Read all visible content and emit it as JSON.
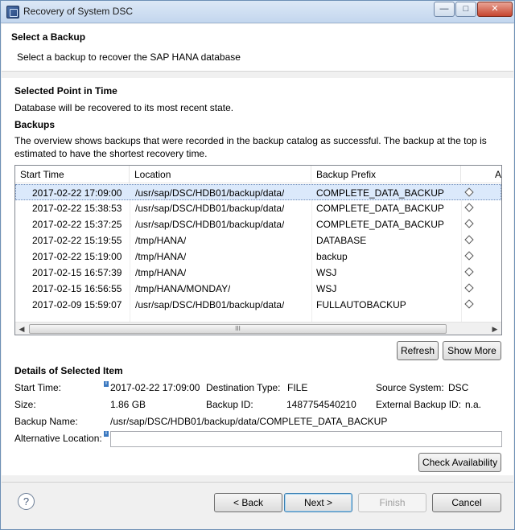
{
  "window": {
    "title": "Recovery of System DSC",
    "min_label": "—",
    "max_label": "□",
    "close_label": "✕"
  },
  "header": {
    "title": "Select a Backup",
    "description": "Select a backup to recover the SAP HANA database"
  },
  "point_in_time": {
    "heading": "Selected Point in Time",
    "text": "Database will be recovered to its most recent state."
  },
  "backups": {
    "heading": "Backups",
    "description_line1": "The overview shows backups that were recorded in the backup catalog as successful. The backup at the top is",
    "description_line2": "estimated to have the shortest recovery time.",
    "columns": [
      "Start Time",
      "Location",
      "Backup Prefix",
      "A"
    ],
    "rows": [
      {
        "start": "2017-02-22 17:09:00",
        "location": "/usr/sap/DSC/HDB01/backup/data/",
        "prefix": "COMPLETE_DATA_BACKUP"
      },
      {
        "start": "2017-02-22 15:38:53",
        "location": "/usr/sap/DSC/HDB01/backup/data/",
        "prefix": "COMPLETE_DATA_BACKUP"
      },
      {
        "start": "2017-02-22 15:37:25",
        "location": "/usr/sap/DSC/HDB01/backup/data/",
        "prefix": "COMPLETE_DATA_BACKUP"
      },
      {
        "start": "2017-02-22 15:19:55",
        "location": "/tmp/HANA/",
        "prefix": "DATABASE"
      },
      {
        "start": "2017-02-22 15:19:00",
        "location": "/tmp/HANA/",
        "prefix": "backup"
      },
      {
        "start": "2017-02-15 16:57:39",
        "location": "/tmp/HANA/",
        "prefix": "WSJ"
      },
      {
        "start": "2017-02-15 16:56:55",
        "location": "/tmp/HANA/MONDAY/",
        "prefix": "WSJ"
      },
      {
        "start": "2017-02-09 15:59:07",
        "location": "/usr/sap/DSC/HDB01/backup/data/",
        "prefix": "FULLAUTOBACKUP"
      }
    ],
    "scroll_thumb_grip": "III",
    "refresh_label": "Refresh",
    "show_more_label": "Show More"
  },
  "details": {
    "heading": "Details of Selected Item",
    "start_time_label": "Start Time:",
    "start_time_value": "2017-02-22 17:09:00",
    "destination_type_label": "Destination Type:",
    "destination_type_value": "FILE",
    "source_system_label": "Source System:",
    "source_system_value": "DSC",
    "size_label": "Size:",
    "size_value": "1.86 GB",
    "backup_id_label": "Backup ID:",
    "backup_id_value": "1487754540210",
    "external_backup_id_label": "External Backup ID:",
    "external_backup_id_value": "n.a.",
    "backup_name_label": "Backup Name:",
    "backup_name_value": "/usr/sap/DSC/HDB01/backup/data/COMPLETE_DATA_BACKUP",
    "alt_location_label": "Alternative Location:",
    "alt_location_value": "",
    "info_marker": "i",
    "check_availability_label": "Check Availability"
  },
  "footer": {
    "help_label": "?",
    "back_label": "< Back",
    "next_label": "Next >",
    "finish_label": "Finish",
    "cancel_label": "Cancel"
  }
}
